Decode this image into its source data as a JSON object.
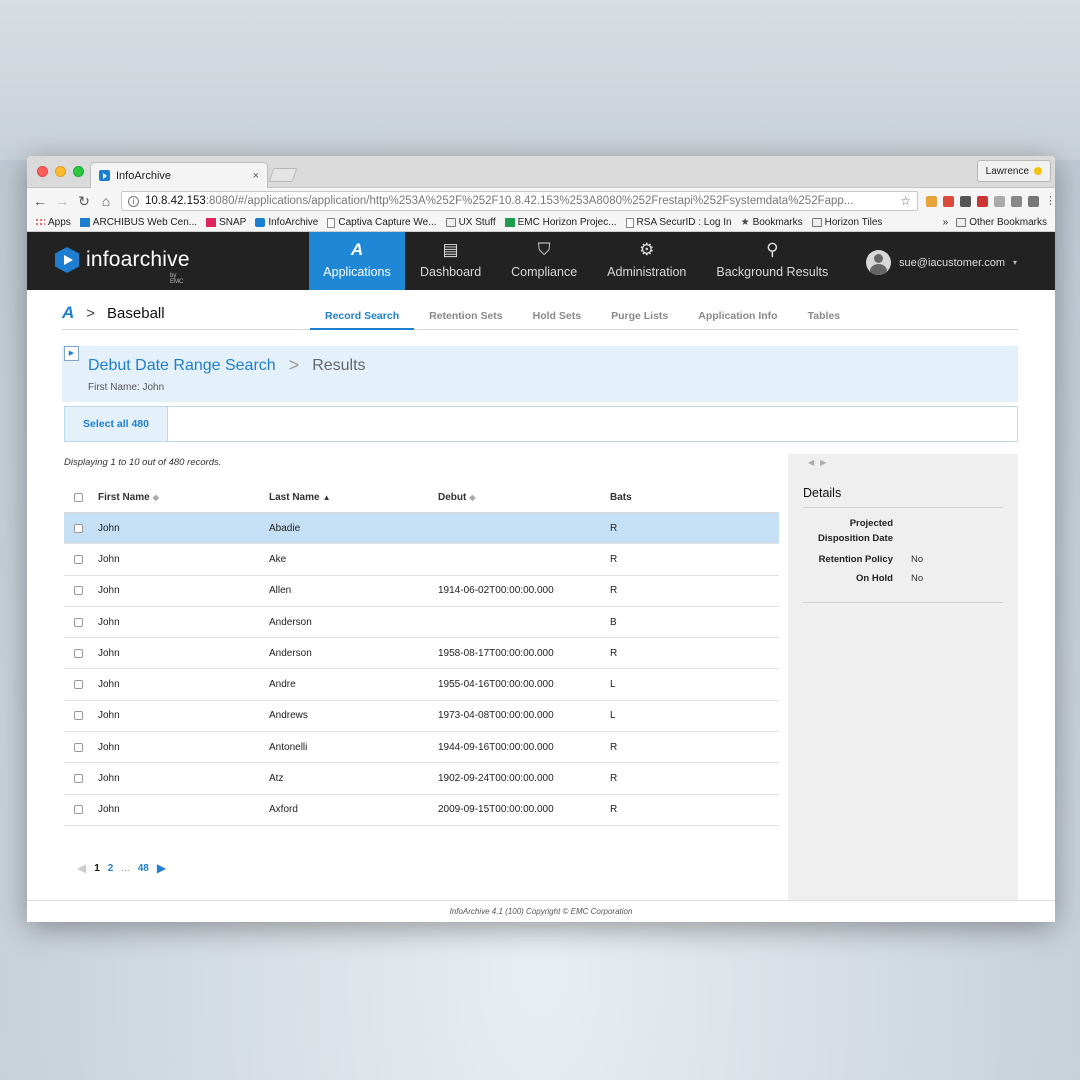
{
  "browser": {
    "tab_title": "InfoArchive",
    "tab_close": "×",
    "profile_name": "Lawrence",
    "url_host": "10.8.42.153",
    "url_rest": ":8080/#/applications/application/http%253A%252F%252F10.8.42.153%253A8080%252Frestapi%252Fsystemdata%252Fapp...",
    "bookmarks": [
      {
        "label": "Apps",
        "icon": "apps-grid-icon"
      },
      {
        "label": "ARCHIBUS Web Cen...",
        "icon": "archibus-icon"
      },
      {
        "label": "SNAP",
        "icon": "snap-icon"
      },
      {
        "label": "InfoArchive",
        "icon": "infoarchive-icon"
      },
      {
        "label": "Captiva Capture We...",
        "icon": "page-icon"
      },
      {
        "label": "UX Stuff",
        "icon": "folder-icon"
      },
      {
        "label": "EMC Horizon Projec...",
        "icon": "sheet-icon"
      },
      {
        "label": "RSA SecurID : Log In",
        "icon": "page-icon"
      },
      {
        "label": "Bookmarks",
        "icon": "star-icon"
      },
      {
        "label": "Horizon Tiles",
        "icon": "folder-icon"
      }
    ],
    "bookmarks_overflow": "»",
    "other_bookmarks": "Other Bookmarks"
  },
  "app": {
    "logo_text": "infoarchive",
    "logo_sub": "by EMC",
    "nav": [
      {
        "label": "Applications",
        "icon": "applications-icon",
        "active": true
      },
      {
        "label": "Dashboard",
        "icon": "dashboard-icon",
        "active": false
      },
      {
        "label": "Compliance",
        "icon": "compliance-shield-icon",
        "active": false
      },
      {
        "label": "Administration",
        "icon": "gear-icon",
        "active": false
      },
      {
        "label": "Background Results",
        "icon": "search-icon",
        "active": false
      }
    ],
    "user_email": "sue@iacustomer.com",
    "accent_color": "#1e88d6"
  },
  "subnav": {
    "app_title": "Baseball",
    "tabs": [
      "Record Search",
      "Retention Sets",
      "Hold Sets",
      "Purge Lists",
      "Application Info",
      "Tables"
    ],
    "active_tab": "Record Search"
  },
  "search": {
    "name": "Debut Date Range Search",
    "results_label": "Results",
    "criteria": "First Name: John",
    "select_all": "Select all 480",
    "displaying": "Displaying 1 to 10 out of 480 records."
  },
  "table": {
    "columns": [
      "First Name",
      "Last Name",
      "Debut",
      "Bats"
    ],
    "sorted_column": "Last Name",
    "rows": [
      {
        "first": "John",
        "last": "Abadie",
        "debut": "",
        "bats": "R",
        "selected": true
      },
      {
        "first": "John",
        "last": "Ake",
        "debut": "",
        "bats": "R",
        "selected": false
      },
      {
        "first": "John",
        "last": "Allen",
        "debut": "1914-06-02T00:00:00.000",
        "bats": "R",
        "selected": false
      },
      {
        "first": "John",
        "last": "Anderson",
        "debut": "",
        "bats": "B",
        "selected": false
      },
      {
        "first": "John",
        "last": "Anderson",
        "debut": "1958-08-17T00:00:00.000",
        "bats": "R",
        "selected": false
      },
      {
        "first": "John",
        "last": "Andre",
        "debut": "1955-04-16T00:00:00.000",
        "bats": "L",
        "selected": false
      },
      {
        "first": "John",
        "last": "Andrews",
        "debut": "1973-04-08T00:00:00.000",
        "bats": "L",
        "selected": false
      },
      {
        "first": "John",
        "last": "Antonelli",
        "debut": "1944-09-16T00:00:00.000",
        "bats": "R",
        "selected": false
      },
      {
        "first": "John",
        "last": "Atz",
        "debut": "1902-09-24T00:00:00.000",
        "bats": "R",
        "selected": false
      },
      {
        "first": "John",
        "last": "Axford",
        "debut": "2009-09-15T00:00:00.000",
        "bats": "R",
        "selected": false
      }
    ]
  },
  "pagination": {
    "current": "1",
    "pages": [
      "2"
    ],
    "ellipsis": "...",
    "last": "48"
  },
  "details": {
    "title": "Details",
    "fields": [
      {
        "key": "Projected Disposition Date",
        "value": ""
      },
      {
        "key": "Retention Policy",
        "value": "No"
      },
      {
        "key": "On Hold",
        "value": "No"
      }
    ]
  },
  "footer": "InfoArchive 4.1 (100) Copyright © EMC Corporation"
}
